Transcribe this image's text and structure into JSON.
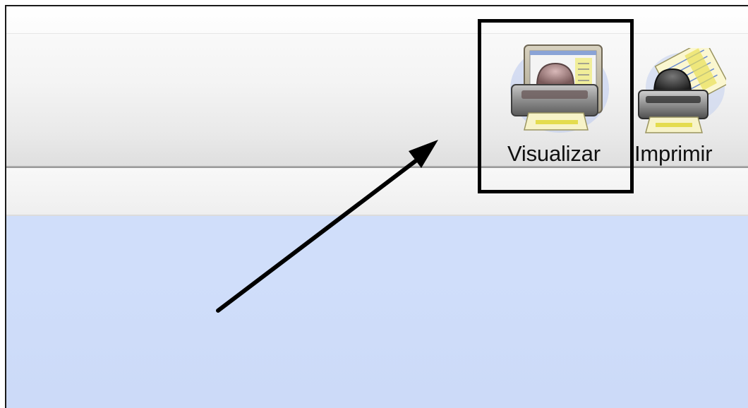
{
  "toolbar": {
    "buttons": [
      {
        "label": "Visualizar",
        "icon": "print-preview-icon"
      },
      {
        "label": "Imprimir",
        "icon": "printer-icon"
      }
    ]
  },
  "colors": {
    "content_background": "#d0defa",
    "annotation": "#000000"
  }
}
